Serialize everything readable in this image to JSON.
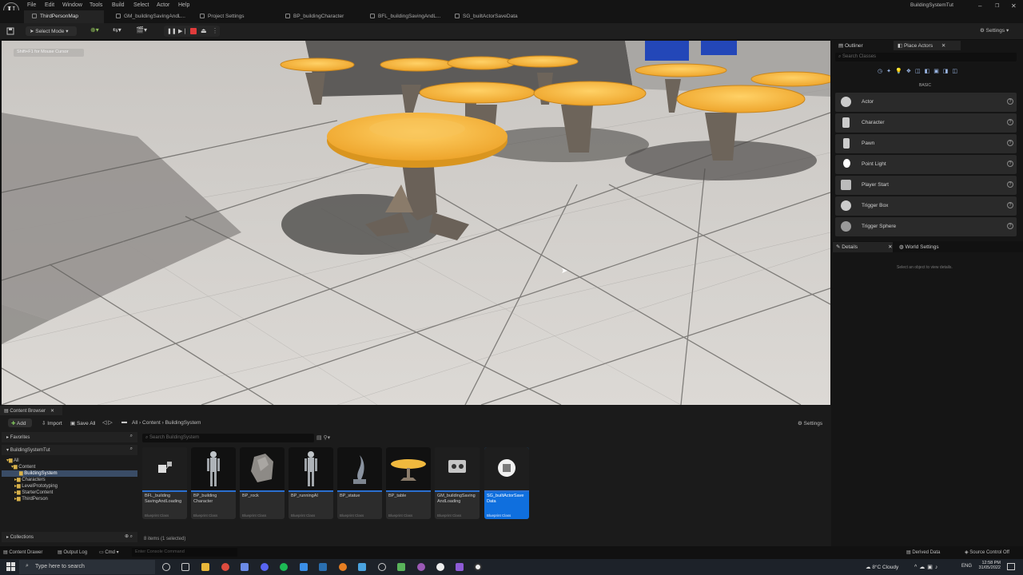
{
  "menu": [
    "File",
    "Edit",
    "Window",
    "Tools",
    "Build",
    "Select",
    "Actor",
    "Help"
  ],
  "window_title": "BuildingSystemTut",
  "doc_tabs": [
    "ThirdPersonMap",
    "GM_buildingSavingAndL...",
    "Project Settings",
    "BP_buildingCharacter",
    "BFL_buildingSavingAndL...",
    "SG_builtActorSaveData"
  ],
  "toolbar": {
    "select_mode": "Select Mode",
    "settings": "Settings"
  },
  "viewport": {
    "hint": "Shift+F1 for Mouse Cursor"
  },
  "outliner": {
    "tab_outliner": "Outliner",
    "tab_place": "Place Actors",
    "search_placeholder": "Search Classes",
    "category": "BASIC",
    "actors": [
      "Actor",
      "Character",
      "Pawn",
      "Point Light",
      "Player Start",
      "Trigger Box",
      "Trigger Sphere"
    ]
  },
  "details": {
    "tab_details": "Details",
    "tab_world": "World Settings",
    "empty": "Select an object to view details."
  },
  "content_browser": {
    "title": "Content Browser",
    "add": "Add",
    "import": "Import",
    "save_all": "Save All",
    "path": [
      "All",
      "Content",
      "BuildingSystem"
    ],
    "settings": "Settings",
    "favorites": "Favorites",
    "project": "BuildingSystemTut",
    "tree": [
      "All",
      "Content",
      "BuildingSystem",
      "Characters",
      "LevelPrototyping",
      "StarterContent",
      "ThirdPerson"
    ],
    "search_placeholder": "Search BuildingSystem",
    "collections": "Collections",
    "count": "8 items (1 selected)",
    "assets": [
      {
        "name": "BFL_building SavingAndLoading",
        "cls": "Blueprint Class"
      },
      {
        "name": "BP_building Character",
        "cls": "Blueprint Class"
      },
      {
        "name": "BP_rock",
        "cls": "Blueprint Class"
      },
      {
        "name": "BP_runningAI",
        "cls": "Blueprint Class"
      },
      {
        "name": "BP_statue",
        "cls": "Blueprint Class"
      },
      {
        "name": "BP_table",
        "cls": "Blueprint Class"
      },
      {
        "name": "GM_buildingSaving AndLoading",
        "cls": "Blueprint Class"
      },
      {
        "name": "SG_builtActorSave Data",
        "cls": "Blueprint Class"
      }
    ]
  },
  "statusbar": {
    "drawer": "Content Drawer",
    "output": "Output Log",
    "cmd": "Cmd",
    "console_placeholder": "Enter Console Command",
    "derived": "Derived Data",
    "source": "Source Control Off"
  },
  "taskbar": {
    "search": "Type here to search",
    "weather": "8°C  Cloudy",
    "lang": "ENG",
    "time": "12:58 PM",
    "date": "31/05/2022"
  },
  "colors": {
    "accent": "#0f6fde",
    "table_top": "#f2b43a",
    "floor": "#d6d3cf"
  }
}
